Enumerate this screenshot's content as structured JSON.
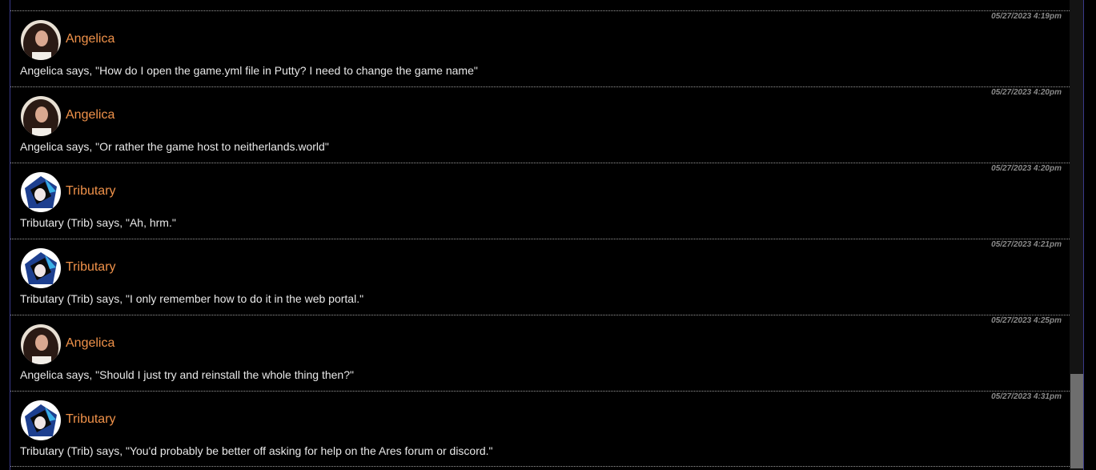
{
  "messages": [
    {
      "author": "Angelica",
      "avatar": "angelica-avatar",
      "timestamp": "05/27/2023 4:19pm",
      "text": "Angelica says, \"How do I open the game.yml file in Putty? I need to change the game name\""
    },
    {
      "author": "Angelica",
      "avatar": "angelica-avatar",
      "timestamp": "05/27/2023 4:20pm",
      "text": "Angelica says, \"Or rather the game host to neitherlands.world\""
    },
    {
      "author": "Tributary",
      "avatar": "tributary-avatar",
      "timestamp": "05/27/2023 4:20pm",
      "text": "Tributary (Trib) says, \"Ah, hrm.\""
    },
    {
      "author": "Tributary",
      "avatar": "tributary-avatar",
      "timestamp": "05/27/2023 4:21pm",
      "text": "Tributary (Trib) says, \"I only remember how to do it in the web portal.\""
    },
    {
      "author": "Angelica",
      "avatar": "angelica-avatar",
      "timestamp": "05/27/2023 4:25pm",
      "text": "Angelica says, \"Should I just try and reinstall the whole thing then?\""
    },
    {
      "author": "Tributary",
      "avatar": "tributary-avatar",
      "timestamp": "05/27/2023 4:31pm",
      "text": "Tributary (Trib) says, \"You'd probably be better off asking for help on the Ares forum or discord.\""
    }
  ],
  "colors": {
    "background": "#000000",
    "author_name": "#f0924a",
    "message_text": "#e8e8e8",
    "timestamp": "#8a8a8a",
    "separator": "#9a9a9a"
  }
}
